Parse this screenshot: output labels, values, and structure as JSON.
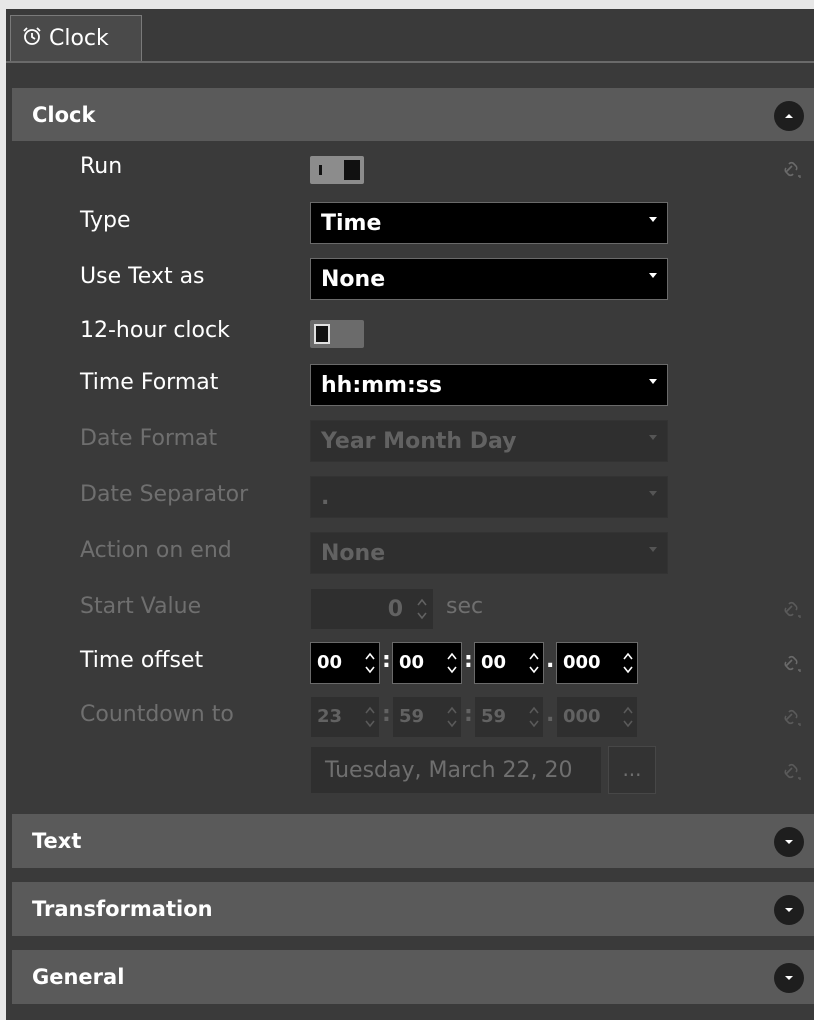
{
  "tab": {
    "label": "Clock",
    "icon": "alarm-clock-icon"
  },
  "sections": {
    "clock": {
      "title": "Clock",
      "expanded": true
    },
    "text": {
      "title": "Text"
    },
    "transformation": {
      "title": "Transformation"
    },
    "general": {
      "title": "General"
    }
  },
  "fields": {
    "run": {
      "label": "Run",
      "on": true
    },
    "type": {
      "label": "Type",
      "value": "Time"
    },
    "use_text_as": {
      "label": "Use Text as",
      "value": "None"
    },
    "twelve_hour": {
      "label": "12-hour clock",
      "on": false
    },
    "time_format": {
      "label": "Time Format",
      "value": "hh:mm:ss"
    },
    "date_format": {
      "label": "Date Format",
      "value": "Year Month Day"
    },
    "date_separator": {
      "label": "Date Separator",
      "value": "."
    },
    "action_on_end": {
      "label": "Action on end",
      "value": "None"
    },
    "start_value": {
      "label": "Start Value",
      "value": "0",
      "unit": "sec"
    },
    "time_offset": {
      "label": "Time offset",
      "h": "00",
      "m": "00",
      "s": "00",
      "ms": "000"
    },
    "countdown_to": {
      "label": "Countdown to",
      "h": "23",
      "m": "59",
      "s": "59",
      "ms": "000",
      "date": "Tuesday, March 22, 20",
      "button": "..."
    }
  },
  "colors": {
    "background": "#3a3a3a",
    "header": "#5a5a5a",
    "field": "#000000",
    "disabled_text": "#6f6f6f"
  }
}
